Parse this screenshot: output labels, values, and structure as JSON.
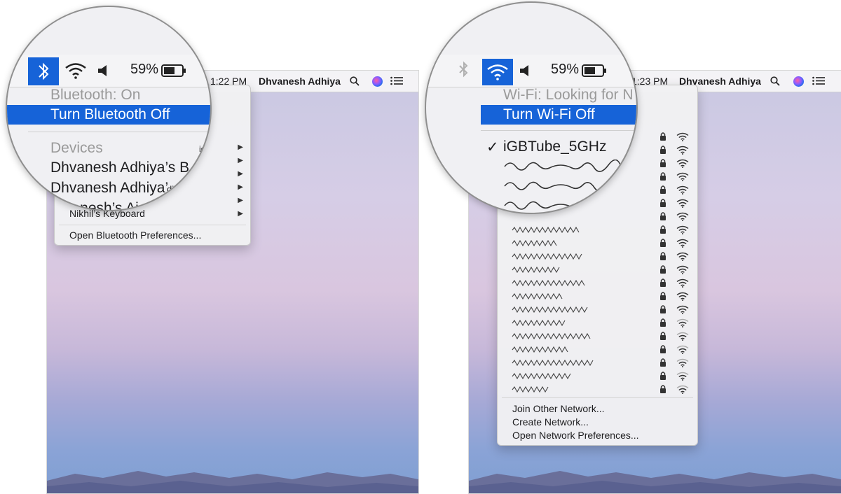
{
  "left": {
    "menubar": {
      "time": "1:22 PM",
      "user": "Dhvanesh Adhiya"
    },
    "magnifier": {
      "battery": "59%",
      "bluetooth_status": "Bluetooth: On",
      "toggle_label": "Turn Bluetooth Off",
      "devices_heading": "Devices",
      "device_1": "Dhvanesh Adhiya’s B",
      "device_2": "Dhvanesh Adhiya’",
      "device_2_suffix": "dio³",
      "device_3": "vanesh’s Ai",
      "device_0_suffix": "io³"
    },
    "menu": {
      "items": [
        "Nikhil’s Keyboard"
      ],
      "preferences": "Open Bluetooth Preferences..."
    }
  },
  "right": {
    "menubar": {
      "time": "1:23 PM",
      "user": "Dhvanesh Adhiya"
    },
    "magnifier": {
      "battery": "59%",
      "wifi_status": "Wi-Fi: Looking for N",
      "toggle_label": "Turn Wi-Fi Off",
      "connected_network": "iGBTube_5GHz",
      "checkmark": "✓"
    },
    "menu": {
      "join_other": "Join Other Network...",
      "create": "Create Network...",
      "preferences": "Open Network Preferences..."
    }
  },
  "icons": {
    "bluetooth": "bluetooth-icon",
    "wifi": "wifi-icon",
    "volume": "volume-icon",
    "battery": "battery-icon",
    "search": "search-icon",
    "siri": "siri-icon",
    "notification_center": "notification-center-icon",
    "lock": "lock-icon",
    "chevron": "chevron-right-icon"
  },
  "colors": {
    "highlight": "#1663d8",
    "menubar": "#f5f5f7"
  }
}
